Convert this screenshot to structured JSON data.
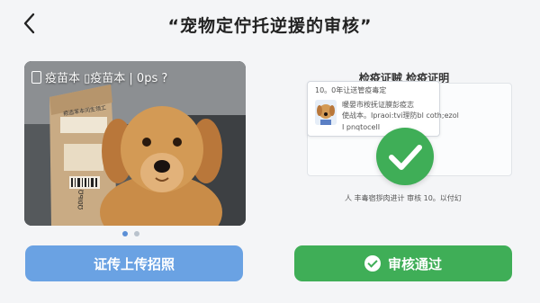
{
  "header": {
    "title": "“宠物定佇托逆援的审核”"
  },
  "photo_card": {
    "overlay_text": "疫苗本 ▯疫苗本 | 0ps ?",
    "box_label": "疤造苯本问生领工",
    "box_code": "Ω0ΙЬΩ",
    "carousel_pages": 2,
    "carousel_active": 1
  },
  "certificate": {
    "title": "检疫证贼  检疫证明",
    "line1": "10。0年让送管疫毒定",
    "line2": "暖晏市桉抚证膜彭疫志",
    "line3": "使战本。Ipraoi:tvi理防bl coth;ezol",
    "line4": "I pnqtocelI",
    "footnote": "人  丰毒宿拶肉进计 审核 10。以付幻",
    "status_color": "#3fae57"
  },
  "buttons": {
    "upload_label": "证传上传招照",
    "approved_label": "审核通过",
    "upload_color": "#6aa2e3",
    "approved_color": "#3fae57"
  }
}
